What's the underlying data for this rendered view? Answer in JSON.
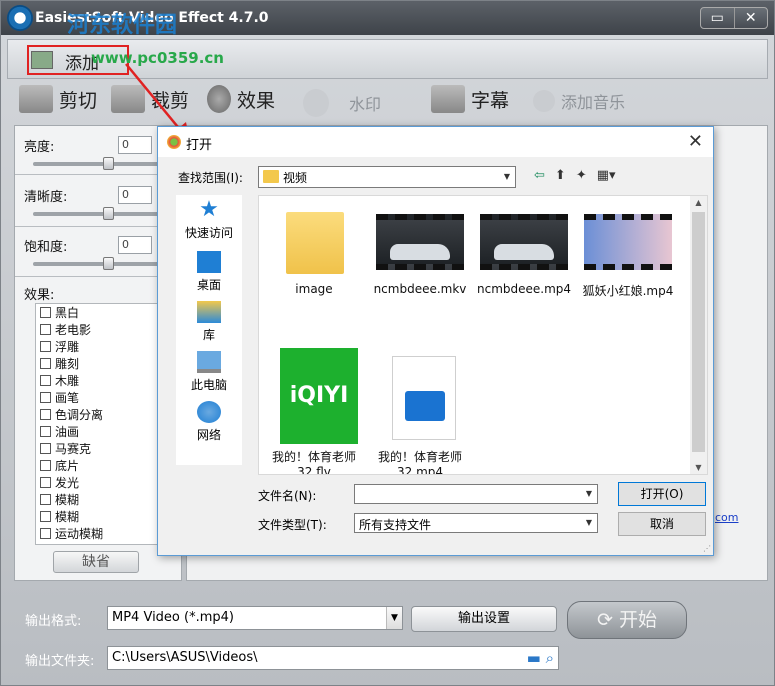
{
  "app": {
    "title": "EasiestSoft Video Effect 4.7.0",
    "watermark_top": "河东软件园",
    "watermark_url": "www.pc0359.cn",
    "window_buttons": [
      "▭",
      "✕"
    ]
  },
  "addbar": {
    "add_label": "添加"
  },
  "toolbar": {
    "items": [
      {
        "label": "剪切",
        "enabled": true
      },
      {
        "label": "裁剪",
        "enabled": true
      },
      {
        "label": "效果",
        "enabled": true
      },
      {
        "label": "水印",
        "enabled": false
      },
      {
        "label": "字幕",
        "enabled": true
      },
      {
        "label": "添加音乐",
        "enabled": false
      }
    ]
  },
  "adjust": {
    "brightness": {
      "label": "亮度:",
      "value": "0",
      "level_fraction": 0.5
    },
    "sharpness": {
      "label": "清晰度:",
      "value": "0",
      "level_fraction": 0.5
    },
    "saturation": {
      "label": "饱和度:",
      "value": "0",
      "level_fraction": 0.5
    }
  },
  "effects": {
    "label": "效果:",
    "items": [
      "黑白",
      "老电影",
      "浮雕",
      "雕刻",
      "木雕",
      "画笔",
      "色调分离",
      "油画",
      "马赛克",
      "底片",
      "发光",
      "模糊",
      "模糊",
      "运动模糊"
    ],
    "default_button": "缺省"
  },
  "right": {
    "link": "com"
  },
  "output": {
    "format_label": "输出格式:",
    "format_value": "MP4 Video (*.mp4)",
    "settings_button": "输出设置",
    "start_button": "开始",
    "folder_label": "输出文件夹:",
    "folder_value": "C:\\Users\\ASUS\\Videos\\"
  },
  "dialog": {
    "title": "打开",
    "look_in_label": "查找范围(I):",
    "look_in_value": "视频",
    "places": [
      "快速访问",
      "桌面",
      "库",
      "此电脑",
      "网络"
    ],
    "files": [
      {
        "name": "image",
        "kind": "folder"
      },
      {
        "name": "ncmbdeee.mkv",
        "kind": "video"
      },
      {
        "name": "ncmbdeee.mp4",
        "kind": "video"
      },
      {
        "name": "狐妖小红娘.mp4",
        "kind": "anime"
      },
      {
        "name": "我的！体育老师\n32.flv",
        "kind": "iqiyi"
      },
      {
        "name": "我的！体育老师\n32.mp4",
        "kind": "clapper"
      }
    ],
    "filename_label": "文件名(N):",
    "filename_value": "",
    "filetype_label": "文件类型(T):",
    "filetype_value": "所有支持文件",
    "open_button": "打开(O)",
    "cancel_button": "取消",
    "close_glyph": "✕"
  },
  "colors": {
    "highlight_red": "#e02222",
    "accent_blue": "#0078d7"
  }
}
